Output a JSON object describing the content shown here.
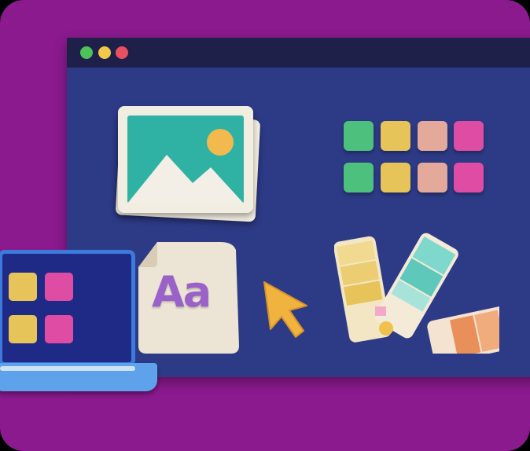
{
  "window": {
    "controls": [
      "green-dot",
      "yellow-dot",
      "red-dot"
    ]
  },
  "colors": {
    "background": "#8a1a8e",
    "window": "#2d3a86",
    "titlebar": "#1e2049",
    "swatch_green": "#4ec07e",
    "swatch_yellow": "#e6c45a",
    "swatch_peach": "#e3a99a",
    "swatch_pink": "#de4ca4",
    "font_letters": "#9a62c9",
    "cursor": "#f0b33f",
    "laptop_frame": "#3c7bdb"
  },
  "font_preview": {
    "sample": "Aa"
  },
  "icons": [
    "image-stack-icon",
    "color-swatch-grid",
    "font-file-icon",
    "cursor-icon",
    "color-palette-fan-icon",
    "laptop-icon"
  ]
}
